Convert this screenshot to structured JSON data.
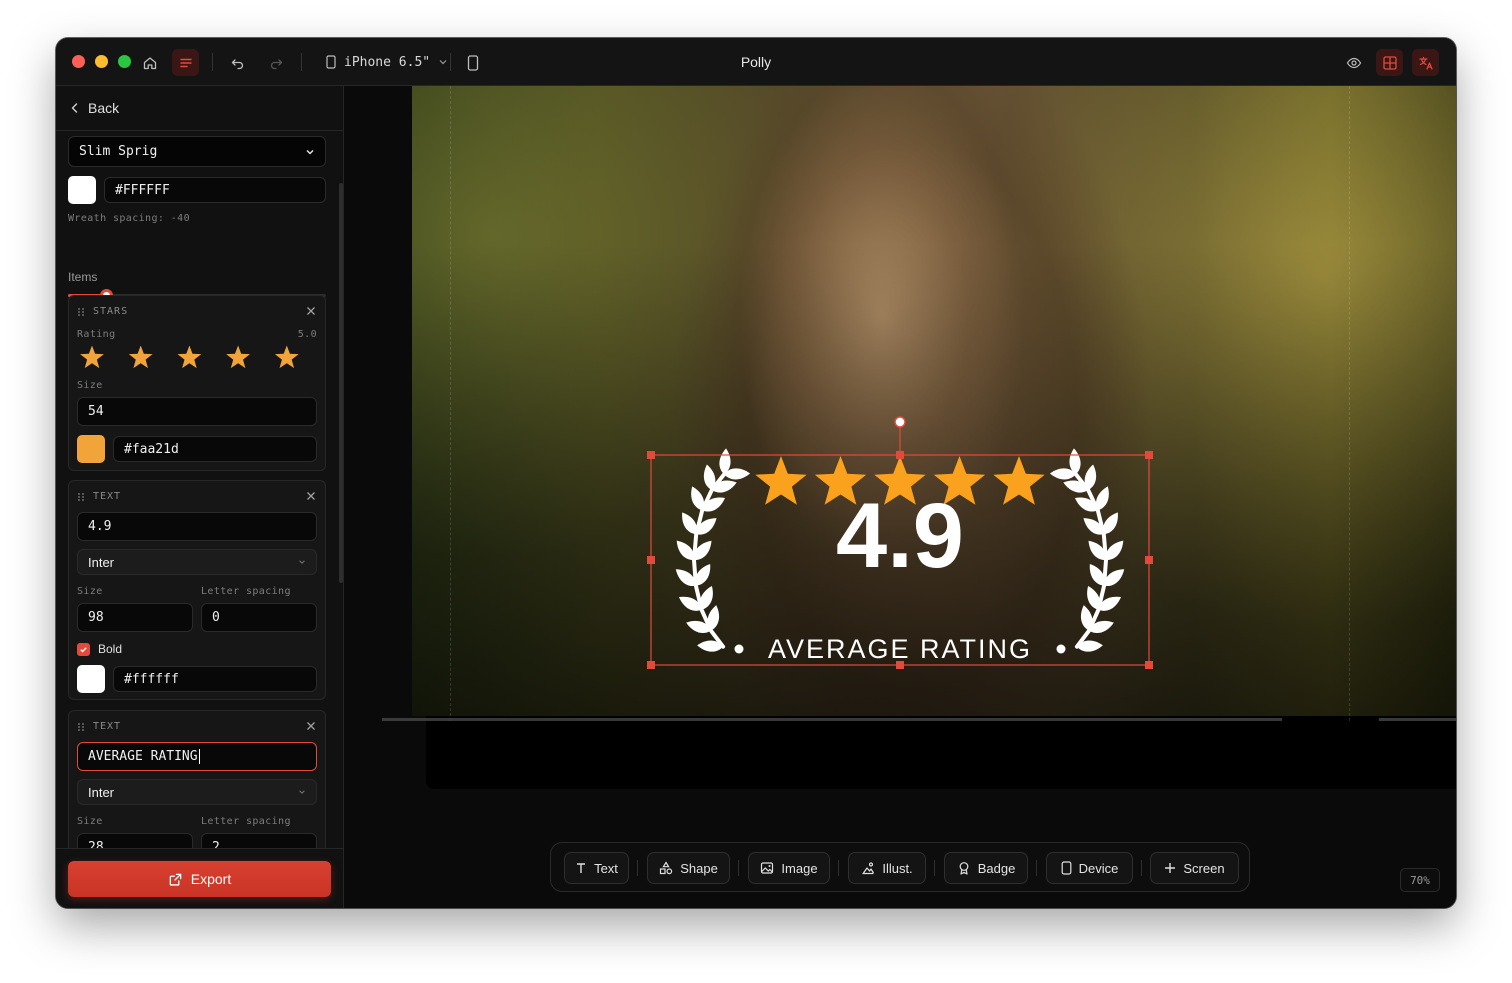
{
  "app": {
    "title": "Polly"
  },
  "titlebar": {
    "device_label": "iPhone 6.5\"",
    "accent": "#e24a3c"
  },
  "sidebar": {
    "back_label": "Back",
    "font_value": "Slim Sprig",
    "color_value": "#FFFFFF",
    "wreath_label": "Wreath spacing: -40",
    "wreath_spacing": -40,
    "items_label": "Items",
    "stars_card": {
      "type_label": "STARS",
      "rating_label": "Rating",
      "rating_value": "5.0",
      "rating": 5,
      "size_label": "Size",
      "size_value": "54",
      "color_value": "#faa21d",
      "color": "#faa21d"
    },
    "text_card_1": {
      "type_label": "TEXT",
      "text_value": "4.9",
      "font_value": "Inter",
      "size_label": "Size",
      "letter_label": "Letter spacing",
      "size_value": "98",
      "letter_value": "0",
      "bold_label": "Bold",
      "bold": true,
      "color_value": "#ffffff"
    },
    "text_card_2": {
      "type_label": "TEXT",
      "text_value": "AVERAGE RATING",
      "font_value": "Inter",
      "size_label": "Size",
      "letter_label": "Letter spacing",
      "size_value": "28",
      "letter_value": "2"
    },
    "export_label": "Export"
  },
  "canvas": {
    "badge_rating": "4.9",
    "badge_caption": "AVERAGE RATING",
    "star_color": "#faa21d",
    "selection_color": "#e24a3c",
    "zoom_label": "70%"
  },
  "toolbar": {
    "text_label": "Text",
    "shape_label": "Shape",
    "image_label": "Image",
    "illust_label": "Illust.",
    "badge_label": "Badge",
    "device_label": "Device",
    "screen_label": "Screen"
  }
}
